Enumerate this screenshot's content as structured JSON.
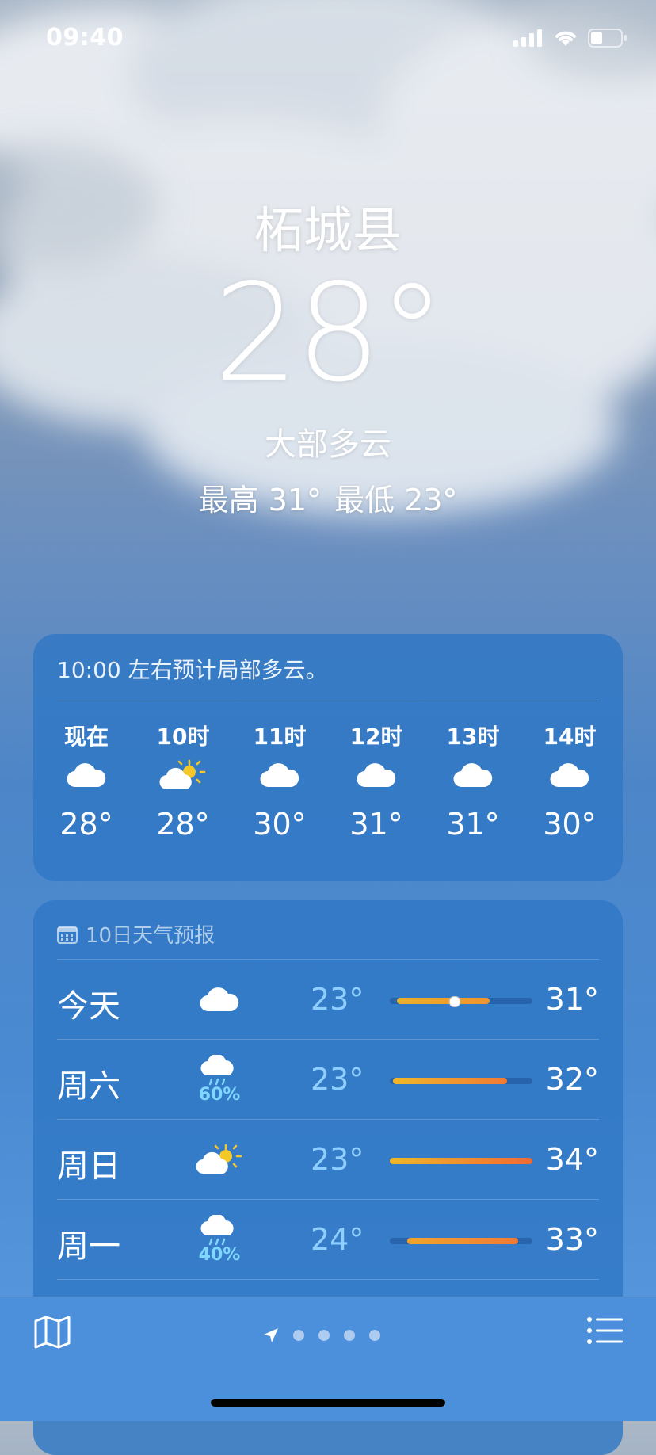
{
  "status_bar": {
    "time": "09:40"
  },
  "location": {
    "city": "柘城县",
    "current_temp": "28°",
    "condition": "大部多云",
    "high": "最高 31°",
    "low": "最低 23°"
  },
  "hourly": {
    "summary": "10:00 左右预计局部多云。",
    "items": [
      {
        "label": "现在",
        "icon": "cloud-icon",
        "temp": "28°"
      },
      {
        "label": "10时",
        "icon": "partly-sunny-icon",
        "temp": "28°"
      },
      {
        "label": "11时",
        "icon": "cloud-icon",
        "temp": "30°"
      },
      {
        "label": "12时",
        "icon": "cloud-icon",
        "temp": "31°"
      },
      {
        "label": "13时",
        "icon": "cloud-icon",
        "temp": "31°"
      },
      {
        "label": "14时",
        "icon": "cloud-icon",
        "temp": "30°"
      }
    ]
  },
  "daily": {
    "header": "10日天气预报",
    "days": [
      {
        "name": "今天",
        "icon": "cloud-icon",
        "precip": "",
        "low": "23°",
        "high": "31°",
        "bar_start": 0.05,
        "bar_end": 0.7,
        "now_marker": 0.45,
        "gradient": [
          "#e9b12b",
          "#f0932f"
        ]
      },
      {
        "name": "周六",
        "icon": "rain-cloud-icon",
        "precip": "60%",
        "low": "23°",
        "high": "32°",
        "bar_start": 0.02,
        "bar_end": 0.82,
        "gradient": [
          "#f0b72a",
          "#f07a34"
        ]
      },
      {
        "name": "周日",
        "icon": "partly-sunny-icon",
        "precip": "",
        "low": "23°",
        "high": "34°",
        "bar_start": 0.0,
        "bar_end": 1.0,
        "gradient": [
          "#f0b72a",
          "#f06a34"
        ]
      },
      {
        "name": "周一",
        "icon": "rain-cloud-icon",
        "precip": "40%",
        "low": "24°",
        "high": "33°",
        "bar_start": 0.12,
        "bar_end": 0.9,
        "gradient": [
          "#f0a52c",
          "#f07a34"
        ]
      }
    ]
  },
  "bottom_bar": {
    "page_count": 4
  },
  "colors": {
    "accent_rain": "#7fd6ff",
    "low_temp": "#8fcfff"
  }
}
